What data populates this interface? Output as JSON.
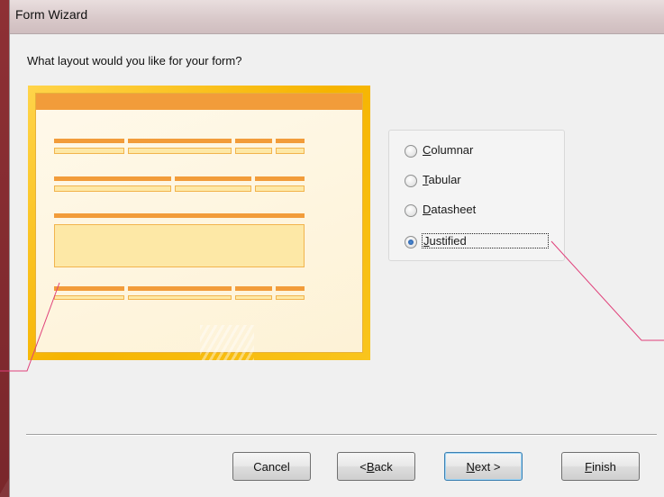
{
  "window": {
    "title": "Form Wizard"
  },
  "prompt": "What layout would you like for your form?",
  "layout_options": [
    {
      "prefix": "",
      "mnemonic": "C",
      "rest": "olumnar",
      "checked": false
    },
    {
      "prefix": "",
      "mnemonic": "T",
      "rest": "abular",
      "checked": false
    },
    {
      "prefix": "",
      "mnemonic": "D",
      "rest": "atasheet",
      "checked": false
    },
    {
      "prefix": "",
      "mnemonic": "J",
      "rest": "ustified",
      "checked": true
    }
  ],
  "buttons": {
    "cancel": {
      "prefix": "Cancel",
      "mnemonic": "",
      "rest": ""
    },
    "back": {
      "prefix": "< ",
      "mnemonic": "B",
      "rest": "ack"
    },
    "next": {
      "prefix": "",
      "mnemonic": "N",
      "rest": "ext >"
    },
    "finish": {
      "prefix": "",
      "mnemonic": "F",
      "rest": "inish"
    }
  },
  "colors": {
    "preview_frame": "#f6b400",
    "preview_bar": "#f29c3a",
    "callout_line": "#e0407a"
  }
}
